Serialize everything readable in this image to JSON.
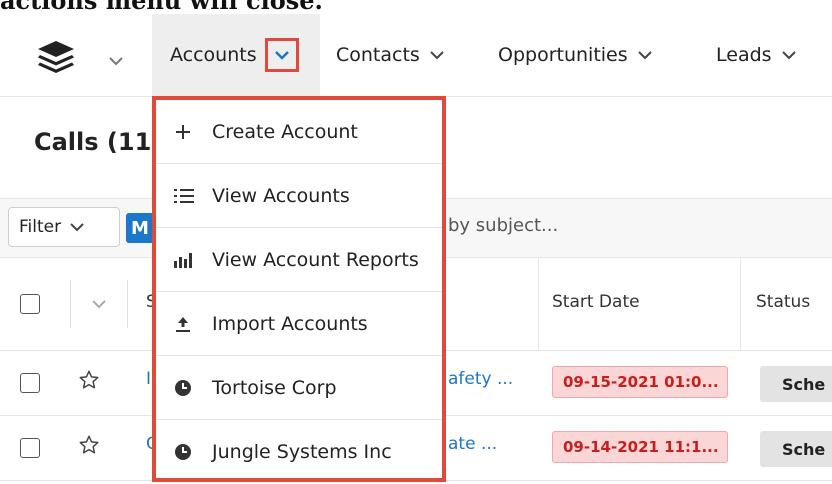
{
  "caption": "actions menu will close.",
  "nav": {
    "items": [
      {
        "label": "Accounts"
      },
      {
        "label": "Contacts"
      },
      {
        "label": "Opportunities"
      },
      {
        "label": "Leads"
      }
    ]
  },
  "page": {
    "title": "Calls (11"
  },
  "toolbar": {
    "filter_label": "Filter",
    "m_label": "M",
    "search_placeholder_fragment": "by subject..."
  },
  "table": {
    "header_s": "S",
    "header_start_date": "Start Date",
    "header_status": "Status",
    "rows": [
      {
        "edge": "I",
        "subject_fragment": "afety ...",
        "start_date": "09-15-2021 01:0...",
        "status": "Sche"
      },
      {
        "edge": "C",
        "subject_fragment": "ate ...",
        "start_date": "09-14-2021 11:1...",
        "status": "Sche"
      }
    ]
  },
  "dropdown": {
    "items": [
      {
        "label": "Create Account",
        "icon": "plus-icon"
      },
      {
        "label": "View Accounts",
        "icon": "list-icon"
      },
      {
        "label": "View Account Reports",
        "icon": "bar-chart-icon"
      },
      {
        "label": "Import Accounts",
        "icon": "upload-icon"
      },
      {
        "label": "Tortoise Corp",
        "icon": "clock-icon"
      },
      {
        "label": "Jungle Systems Inc",
        "icon": "clock-icon"
      }
    ]
  },
  "colors": {
    "highlight": "#e04a3a",
    "link": "#1c76c9",
    "date_overdue_bg": "#fbd6d6",
    "date_overdue_text": "#c81e1e"
  }
}
